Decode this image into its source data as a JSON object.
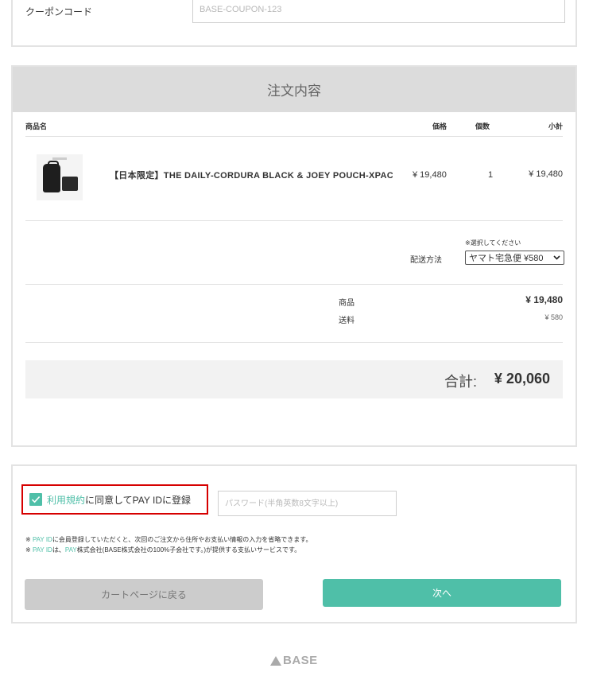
{
  "coupon": {
    "label": "クーポンコード",
    "placeholder": "BASE-COUPON-123"
  },
  "order": {
    "title": "注文内容",
    "columns": {
      "name": "商品名",
      "price": "価格",
      "qty": "個数",
      "subtotal": "小計"
    },
    "product": {
      "name": "【日本限定】THE DAILY-CORDURA BLACK & JOEY POUCH-XPAC",
      "price": "¥ 19,480",
      "qty": "1",
      "subtotal": "¥ 19,480"
    },
    "shipping": {
      "note": "※選択してください",
      "label": "配送方法",
      "selected": "ヤマト宅急便 ¥580"
    },
    "totals": {
      "items_label": "商品",
      "items_value": "¥ 19,480",
      "shipping_label": "送料",
      "shipping_value": "¥ 580"
    },
    "grand": {
      "label": "合計:",
      "value": "¥ 20,060"
    }
  },
  "register": {
    "terms_link": "利用規約",
    "agree_text": "に同意してPAY IDに登録",
    "checked": true,
    "password_placeholder": "パスワード(半角英数8文字以上)",
    "note1_prefix": "※ ",
    "note1_payid": "PAY ID",
    "note1_rest": "に会員登録していただくと、次回のご注文から住所やお支払い情報の入力を省略できます。",
    "note2_prefix": "※ ",
    "note2_payid": "PAY ID",
    "note2_mid": "は、",
    "note2_pay": "PAY",
    "note2_rest": "株式会社(BASE株式会社の100%子会社です。)が提供する支払いサービスです。"
  },
  "buttons": {
    "back": "カートページに戻る",
    "next": "次へ"
  },
  "footer": {
    "logo": "BASE"
  },
  "colors": {
    "accent": "#4fbfa8",
    "highlight_border": "#d60000"
  }
}
